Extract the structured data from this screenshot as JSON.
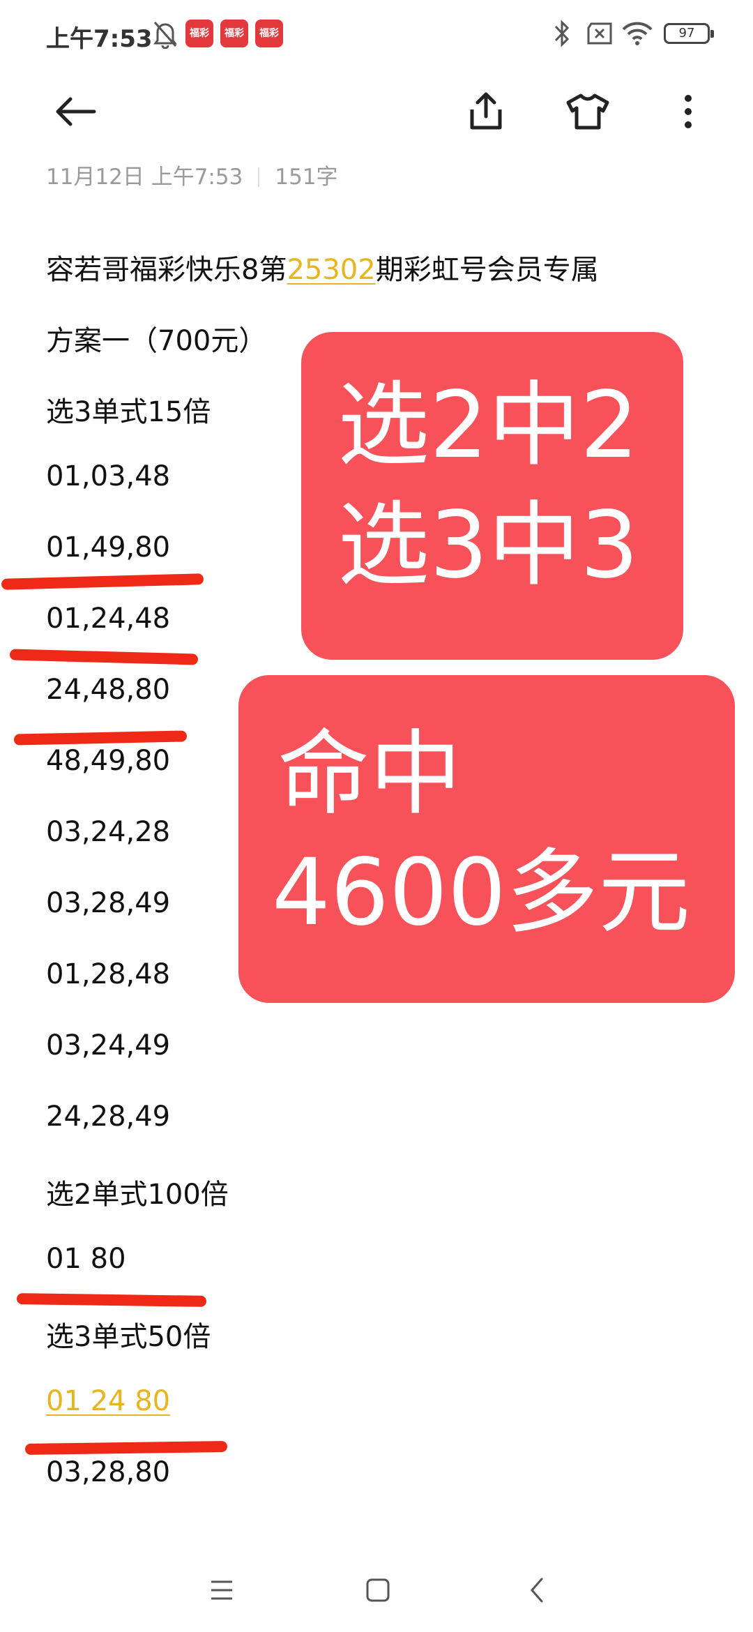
{
  "status_bar": {
    "time": "上午7:53",
    "app_badge_text": "福彩",
    "battery": "97"
  },
  "note": {
    "meta_date": "11月12日  上午7:53",
    "meta_count": "151字",
    "title_prefix": "容若哥福彩快乐8第",
    "title_issue": "25302",
    "title_suffix": "期彩虹号会员专属",
    "lines": [
      "方案一（700元）",
      "选3单式15倍",
      "01,03,48",
      "01,49,80",
      "01,24,48",
      "24,48,80",
      "48,49,80",
      "03,24,28",
      "03,28,49",
      "01,28,48",
      "03,24,49",
      "24,28,49",
      "选2单式100倍",
      "01 80",
      "选3单式50倍",
      "01 24 80",
      "03,28,80"
    ]
  },
  "overlay": {
    "card1_line1": "选2中2",
    "card1_line2": "选3中3",
    "card2_line1": "命中",
    "card2_line2": "4600多元"
  },
  "colors": {
    "card": "#f7525a",
    "mark": "#ee2a17",
    "highlight": "#e8b420"
  },
  "icons": {
    "back": "back-arrow-icon",
    "share": "share-icon",
    "theme": "shirt-icon",
    "more": "more-vert-icon"
  }
}
